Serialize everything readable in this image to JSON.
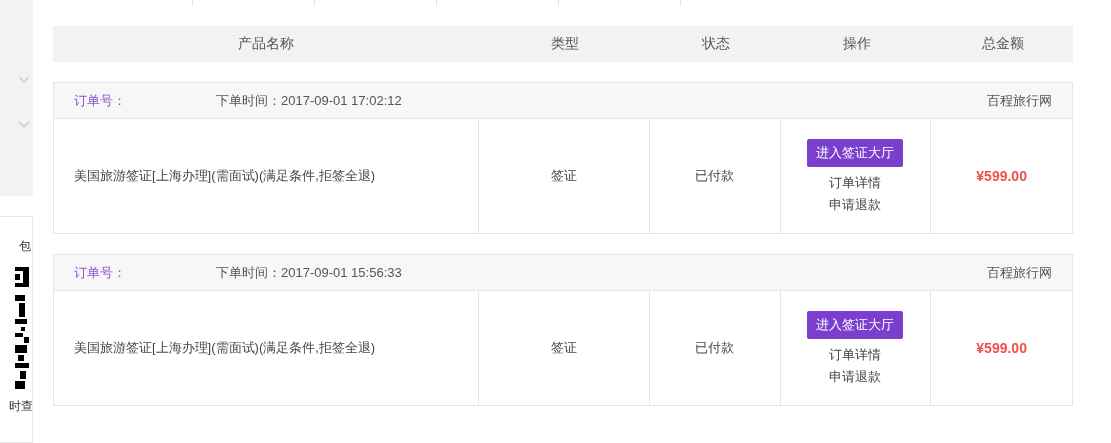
{
  "sidebar": {
    "card_texts": [
      "包",
      "时查"
    ]
  },
  "table": {
    "columns": [
      "产品名称",
      "类型",
      "状态",
      "操作",
      "总金额"
    ]
  },
  "orders": [
    {
      "order_no_label": "订单号：",
      "time_label": "下单时间：2017-09-01 17:02:12",
      "supplier": "百程旅行网",
      "product": "美国旅游签证[上海办理](需面试)(满足条件,拒签全退)",
      "type": "签证",
      "status": "已付款",
      "primary_action": "进入签证大厅",
      "links": [
        "订单详情",
        "申请退款"
      ],
      "total": "¥599.00"
    },
    {
      "order_no_label": "订单号：",
      "time_label": "下单时间：2017-09-01 15:56:33",
      "supplier": "百程旅行网",
      "product": "美国旅游签证[上海办理](需面试)(满足条件,拒签全退)",
      "type": "签证",
      "status": "已付款",
      "primary_action": "进入签证大厅",
      "links": [
        "订单详情",
        "申请退款"
      ],
      "total": "¥599.00"
    }
  ]
}
